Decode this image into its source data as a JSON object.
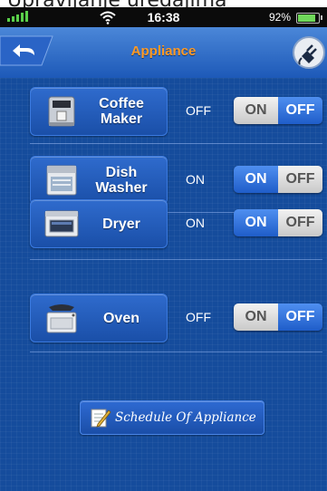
{
  "top_caption": "Upravljanje uređajima",
  "status_bar": {
    "time": "16:38",
    "battery": "92%"
  },
  "nav": {
    "title": "Appliance"
  },
  "appliances": [
    {
      "label": "Coffee\nMaker",
      "status": "OFF",
      "toggle_on": "ON",
      "toggle_off": "OFF",
      "state": "off"
    },
    {
      "label": "Dish\nWasher",
      "status": "ON",
      "toggle_on": "ON",
      "toggle_off": "OFF",
      "state": "on"
    },
    {
      "label": "Dryer",
      "status": "ON",
      "toggle_on": "ON",
      "toggle_off": "OFF",
      "state": "on"
    },
    {
      "label": "Oven",
      "status": "OFF",
      "toggle_on": "ON",
      "toggle_off": "OFF",
      "state": "off"
    }
  ],
  "schedule_button": {
    "label": "Schedule Of Appliance"
  },
  "colors": {
    "background": "#154c9c",
    "title": "#ff9a24",
    "toggle_active": "#2a6cdd",
    "toggle_inactive": "#d9d9d9"
  }
}
